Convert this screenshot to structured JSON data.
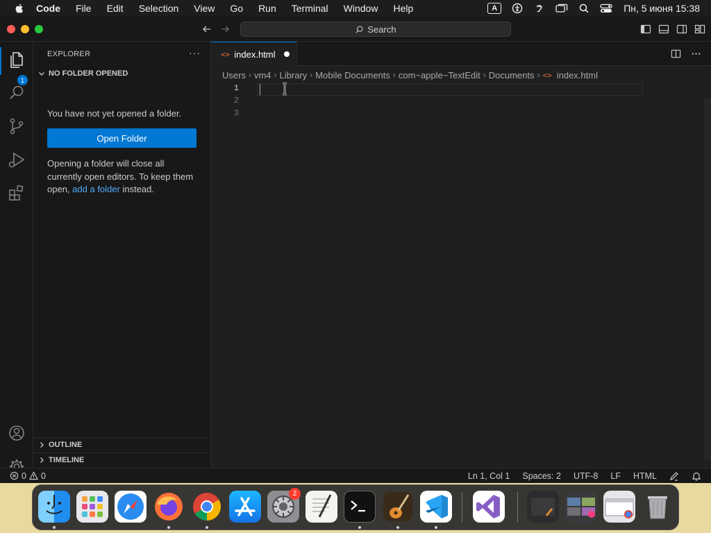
{
  "menubar": {
    "app_name": "Code",
    "items": [
      "File",
      "Edit",
      "Selection",
      "View",
      "Go",
      "Run",
      "Terminal",
      "Window",
      "Help"
    ],
    "input_method": "A",
    "clock": "Пн, 5 июня  15:38"
  },
  "titlebar": {
    "search_label": "Search"
  },
  "activitybar": {
    "explorer_badge": "1",
    "icons": [
      "files-icon",
      "search-icon",
      "source-control-icon",
      "run-debug-icon",
      "extensions-icon",
      "account-icon",
      "gear-icon"
    ]
  },
  "sidebar": {
    "title": "EXPLORER",
    "more": "···",
    "section_title": "NO FOLDER OPENED",
    "empty_message": "You have not yet opened a folder.",
    "open_folder_label": "Open Folder",
    "note_prefix": "Opening a folder will close all currently open editors. To keep them open,",
    "note_link": "add a folder",
    "note_suffix": "instead.",
    "outline_label": "OUTLINE",
    "timeline_label": "TIMELINE"
  },
  "editor": {
    "tab_label": "index.html",
    "tab_icon": "<>",
    "breadcrumb": [
      "Users",
      "vm4",
      "Library",
      "Mobile Documents",
      "com~apple~TextEdit",
      "Documents"
    ],
    "breadcrumb_file": "index.html",
    "line_numbers": [
      "1",
      "2",
      "3"
    ]
  },
  "statusbar": {
    "errors": "0",
    "warnings": "0",
    "position": "Ln 1, Col 1",
    "spaces": "Spaces: 2",
    "encoding": "UTF-8",
    "eol": "LF",
    "language": "HTML"
  },
  "dock": {
    "apps": [
      "Finder",
      "Launchpad",
      "Safari",
      "Firefox",
      "Chrome",
      "App Store",
      "System Settings",
      "TextEdit",
      "Terminal",
      "GarageBand",
      "Visual Studio Code",
      "Visual Studio",
      "Downloads",
      "Screenshots",
      "Chrome window",
      "Trash"
    ],
    "settings_badge": "2"
  },
  "colors": {
    "accent": "#0078d4",
    "link": "#4daafc",
    "html_icon": "#e37933"
  }
}
